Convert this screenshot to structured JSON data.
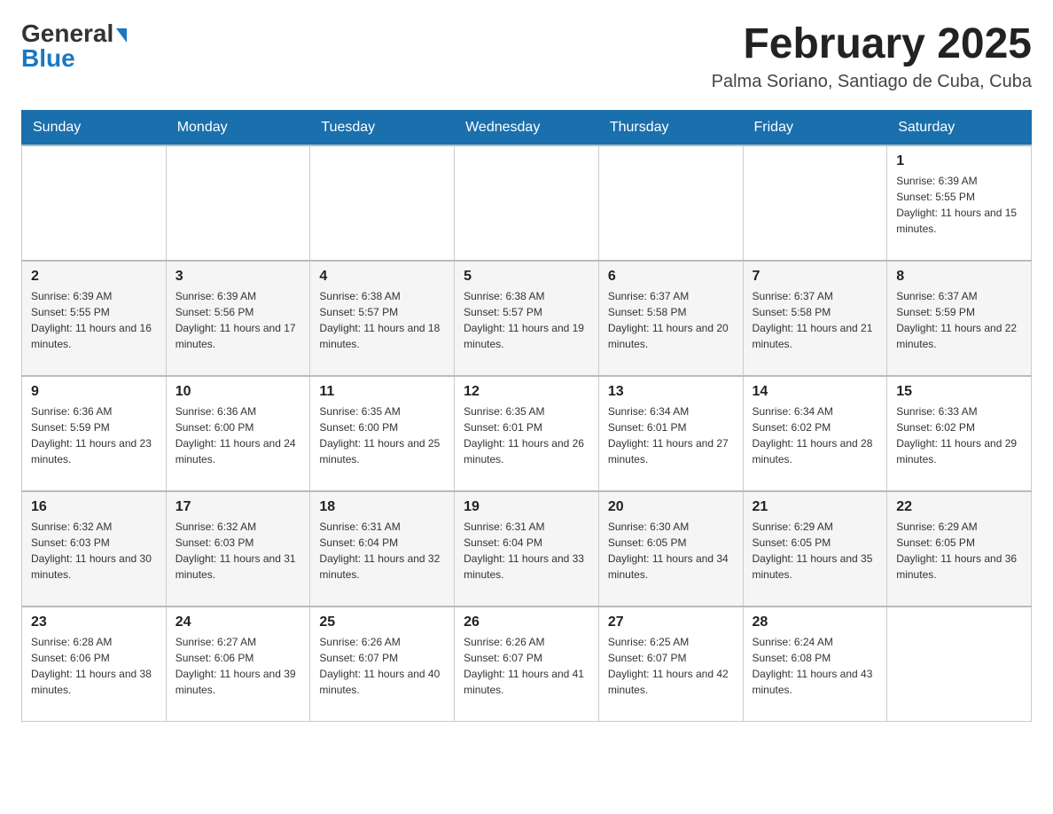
{
  "header": {
    "logo_general": "General",
    "logo_blue": "Blue",
    "month_title": "February 2025",
    "location": "Palma Soriano, Santiago de Cuba, Cuba"
  },
  "days_of_week": [
    "Sunday",
    "Monday",
    "Tuesday",
    "Wednesday",
    "Thursday",
    "Friday",
    "Saturday"
  ],
  "weeks": [
    [
      {
        "day": "",
        "info": ""
      },
      {
        "day": "",
        "info": ""
      },
      {
        "day": "",
        "info": ""
      },
      {
        "day": "",
        "info": ""
      },
      {
        "day": "",
        "info": ""
      },
      {
        "day": "",
        "info": ""
      },
      {
        "day": "1",
        "info": "Sunrise: 6:39 AM\nSunset: 5:55 PM\nDaylight: 11 hours and 15 minutes."
      }
    ],
    [
      {
        "day": "2",
        "info": "Sunrise: 6:39 AM\nSunset: 5:55 PM\nDaylight: 11 hours and 16 minutes."
      },
      {
        "day": "3",
        "info": "Sunrise: 6:39 AM\nSunset: 5:56 PM\nDaylight: 11 hours and 17 minutes."
      },
      {
        "day": "4",
        "info": "Sunrise: 6:38 AM\nSunset: 5:57 PM\nDaylight: 11 hours and 18 minutes."
      },
      {
        "day": "5",
        "info": "Sunrise: 6:38 AM\nSunset: 5:57 PM\nDaylight: 11 hours and 19 minutes."
      },
      {
        "day": "6",
        "info": "Sunrise: 6:37 AM\nSunset: 5:58 PM\nDaylight: 11 hours and 20 minutes."
      },
      {
        "day": "7",
        "info": "Sunrise: 6:37 AM\nSunset: 5:58 PM\nDaylight: 11 hours and 21 minutes."
      },
      {
        "day": "8",
        "info": "Sunrise: 6:37 AM\nSunset: 5:59 PM\nDaylight: 11 hours and 22 minutes."
      }
    ],
    [
      {
        "day": "9",
        "info": "Sunrise: 6:36 AM\nSunset: 5:59 PM\nDaylight: 11 hours and 23 minutes."
      },
      {
        "day": "10",
        "info": "Sunrise: 6:36 AM\nSunset: 6:00 PM\nDaylight: 11 hours and 24 minutes."
      },
      {
        "day": "11",
        "info": "Sunrise: 6:35 AM\nSunset: 6:00 PM\nDaylight: 11 hours and 25 minutes."
      },
      {
        "day": "12",
        "info": "Sunrise: 6:35 AM\nSunset: 6:01 PM\nDaylight: 11 hours and 26 minutes."
      },
      {
        "day": "13",
        "info": "Sunrise: 6:34 AM\nSunset: 6:01 PM\nDaylight: 11 hours and 27 minutes."
      },
      {
        "day": "14",
        "info": "Sunrise: 6:34 AM\nSunset: 6:02 PM\nDaylight: 11 hours and 28 minutes."
      },
      {
        "day": "15",
        "info": "Sunrise: 6:33 AM\nSunset: 6:02 PM\nDaylight: 11 hours and 29 minutes."
      }
    ],
    [
      {
        "day": "16",
        "info": "Sunrise: 6:32 AM\nSunset: 6:03 PM\nDaylight: 11 hours and 30 minutes."
      },
      {
        "day": "17",
        "info": "Sunrise: 6:32 AM\nSunset: 6:03 PM\nDaylight: 11 hours and 31 minutes."
      },
      {
        "day": "18",
        "info": "Sunrise: 6:31 AM\nSunset: 6:04 PM\nDaylight: 11 hours and 32 minutes."
      },
      {
        "day": "19",
        "info": "Sunrise: 6:31 AM\nSunset: 6:04 PM\nDaylight: 11 hours and 33 minutes."
      },
      {
        "day": "20",
        "info": "Sunrise: 6:30 AM\nSunset: 6:05 PM\nDaylight: 11 hours and 34 minutes."
      },
      {
        "day": "21",
        "info": "Sunrise: 6:29 AM\nSunset: 6:05 PM\nDaylight: 11 hours and 35 minutes."
      },
      {
        "day": "22",
        "info": "Sunrise: 6:29 AM\nSunset: 6:05 PM\nDaylight: 11 hours and 36 minutes."
      }
    ],
    [
      {
        "day": "23",
        "info": "Sunrise: 6:28 AM\nSunset: 6:06 PM\nDaylight: 11 hours and 38 minutes."
      },
      {
        "day": "24",
        "info": "Sunrise: 6:27 AM\nSunset: 6:06 PM\nDaylight: 11 hours and 39 minutes."
      },
      {
        "day": "25",
        "info": "Sunrise: 6:26 AM\nSunset: 6:07 PM\nDaylight: 11 hours and 40 minutes."
      },
      {
        "day": "26",
        "info": "Sunrise: 6:26 AM\nSunset: 6:07 PM\nDaylight: 11 hours and 41 minutes."
      },
      {
        "day": "27",
        "info": "Sunrise: 6:25 AM\nSunset: 6:07 PM\nDaylight: 11 hours and 42 minutes."
      },
      {
        "day": "28",
        "info": "Sunrise: 6:24 AM\nSunset: 6:08 PM\nDaylight: 11 hours and 43 minutes."
      },
      {
        "day": "",
        "info": ""
      }
    ]
  ]
}
